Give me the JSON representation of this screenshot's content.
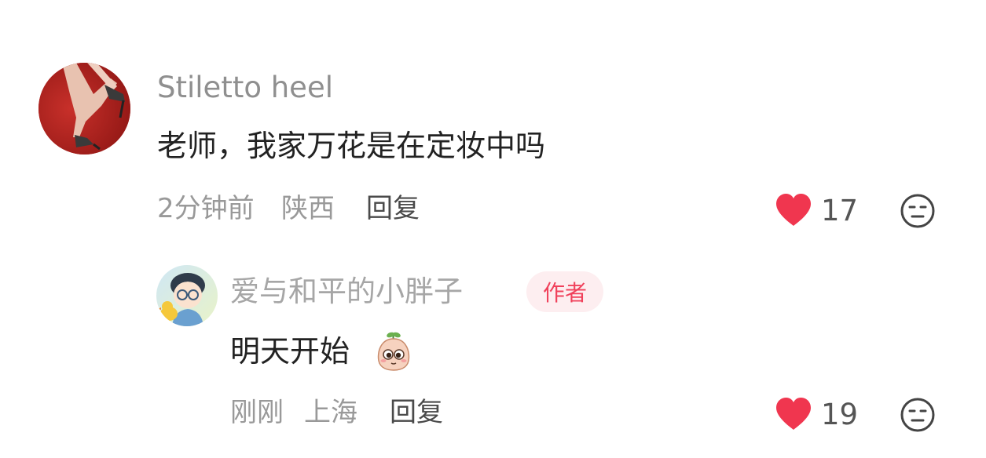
{
  "comment": {
    "username": "Stiletto heel",
    "text": "老师，我家万花是在定妆中吗",
    "time": "2分钟前",
    "location": "陕西",
    "reply_label": "回复",
    "like_count": "17",
    "avatar_icon": "avatar-photo-heels",
    "like_icon": "heart-icon",
    "dislike_icon": "frown-face-icon"
  },
  "reply": {
    "username": "爱与和平的小胖子",
    "badge": "作者",
    "text": "明天开始",
    "emoji_icon": "peach-emoji-icon",
    "time": "刚刚",
    "location": "上海",
    "reply_label": "回复",
    "like_count": "19",
    "avatar_icon": "avatar-cartoon-boy",
    "like_icon": "heart-icon",
    "dislike_icon": "frown-face-icon"
  },
  "colors": {
    "heart": "#f0364f",
    "badge_bg": "#fdeef0",
    "badge_text": "#f0415b",
    "meta_text": "#999999",
    "username_text": "#8f8f8f"
  }
}
